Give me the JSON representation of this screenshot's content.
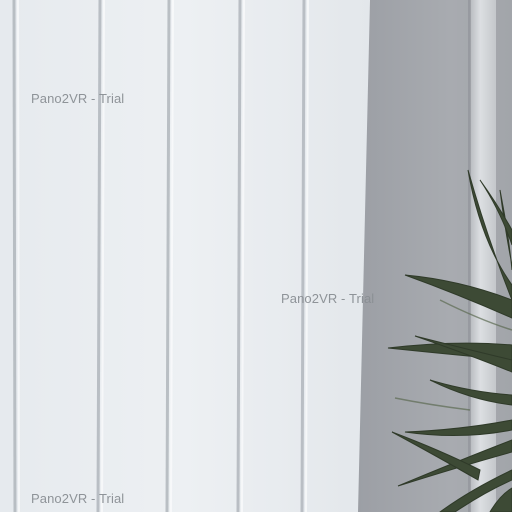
{
  "scene": {
    "colors": {
      "blind_light": "#eef1f4",
      "blind_shadow": "#c9ced3",
      "seam": "#a9afb5",
      "wall": "#a4a7ac",
      "wall_dark": "#8e9196",
      "pipe": "#d5d8db",
      "leaf": "#3d4a35",
      "leaf_light": "#5d6b52"
    },
    "watermarks": [
      "Pano2VR - Trial",
      "Pano2VR - Trial",
      "Pano2VR - Trial"
    ]
  }
}
